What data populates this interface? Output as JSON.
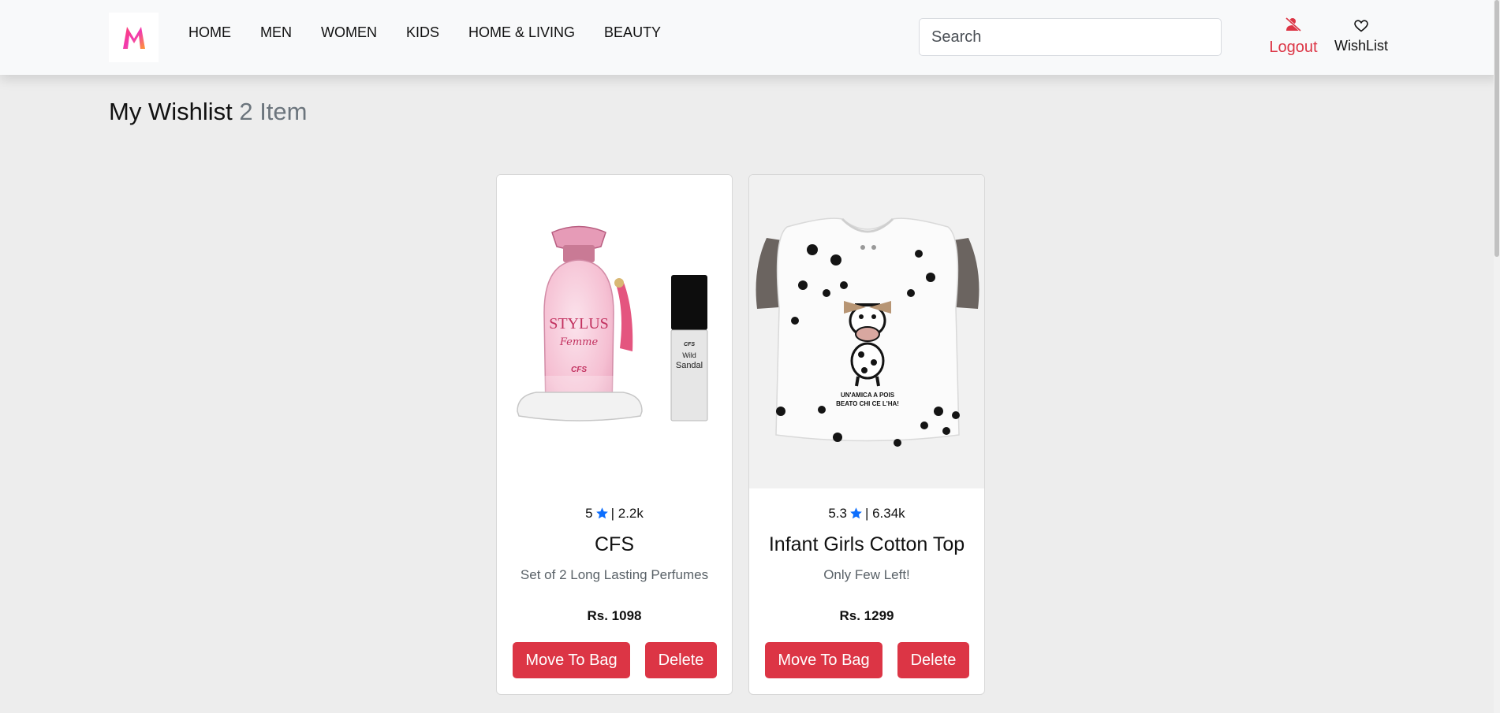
{
  "nav": {
    "menu": [
      "HOME",
      "MEN",
      "WOMEN",
      "KIDS",
      "HOME & LIVING",
      "BEAUTY"
    ],
    "search_placeholder": "Search",
    "logout_label": "Logout",
    "wishlist_label": "WishList"
  },
  "page": {
    "title": "My Wishlist",
    "count": "2 Item"
  },
  "products": [
    {
      "rating": "5",
      "reviews": "| 2.2k",
      "name": "CFS",
      "description": "Set of 2 Long Lasting Perfumes",
      "price": "Rs. 1098",
      "move_label": "Move To Bag",
      "delete_label": "Delete",
      "image_text": {
        "brand": "STYLUS",
        "script": "Femme",
        "logo": "CFS",
        "small_brand": "CFS",
        "small_label_1": "Wild",
        "small_label_2": "Sandal"
      }
    },
    {
      "rating": "5.3",
      "reviews": "| 6.34k",
      "name": "Infant Girls Cotton Top",
      "description": "Only Few Left!",
      "price": "Rs. 1299",
      "move_label": "Move To Bag",
      "delete_label": "Delete",
      "image_text": {
        "line1": "UN'AMICA A POIS",
        "line2": "BEATO CHI CE L'HA!"
      }
    }
  ],
  "colors": {
    "accent": "#dc3545",
    "star": "#0d6efd",
    "nav_bg": "#f8f9fa",
    "page_bg": "#ededed"
  }
}
